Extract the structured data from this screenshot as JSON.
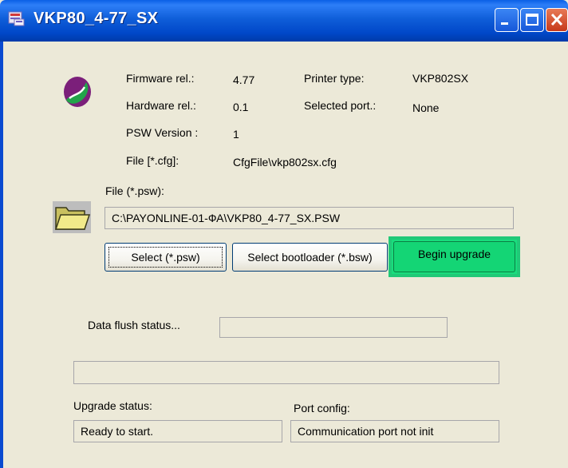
{
  "window": {
    "title": "VKP80_4-77_SX"
  },
  "colors": {
    "titlebar": "#0047c8",
    "begin_upgrade": "#19dd7d"
  },
  "info": {
    "firmware_label": "Firmware rel.:",
    "firmware_value": "4.77",
    "hardware_label": "Hardware rel.:",
    "hardware_value": "0.1",
    "psw_version_label": "PSW Version :",
    "psw_version_value": "1",
    "cfg_label": "File [*.cfg]:",
    "cfg_value": "CfgFile\\vkp802sx.cfg",
    "printer_type_label": "Printer type:",
    "printer_type_value": "VKP802SX",
    "selected_port_label": "Selected port.:",
    "selected_port_value": "None"
  },
  "psw": {
    "label": "File (*.psw):",
    "path": "C:\\PAYONLINE-01-ФА\\VKP80_4-77_SX.PSW"
  },
  "buttons": {
    "select_psw": "Select (*.psw)",
    "select_bootloader": "Select bootloader (*.bsw)",
    "begin_upgrade": "Begin upgrade"
  },
  "status": {
    "data_flush_label": "Data flush status...",
    "data_flush_value": "",
    "progress_value": "",
    "upgrade_label": "Upgrade status:",
    "upgrade_value": "Ready to start.",
    "port_config_label": "Port config:",
    "port_config_value": "Communication port not init"
  }
}
